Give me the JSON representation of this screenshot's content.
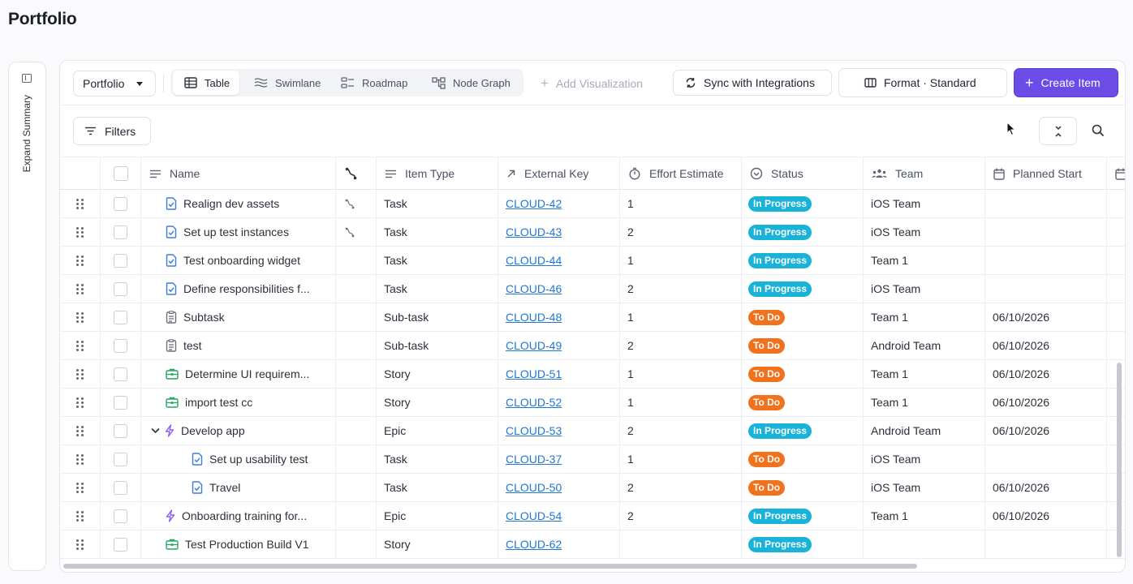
{
  "page": {
    "title": "Portfolio"
  },
  "side_panel": {
    "label": "Expand Summary"
  },
  "toolbar": {
    "portfolio_select": "Portfolio",
    "views": [
      {
        "label": "Table",
        "icon": "table-icon",
        "active": true
      },
      {
        "label": "Swimlane",
        "icon": "swimlane-icon",
        "active": false
      },
      {
        "label": "Roadmap",
        "icon": "roadmap-icon",
        "active": false
      },
      {
        "label": "Node Graph",
        "icon": "node-graph-icon",
        "active": false
      }
    ],
    "add_visualization": "Add Visualization",
    "sync_label": "Sync with Integrations",
    "format_label": "Format · Standard",
    "create_label": "Create Item"
  },
  "filters": {
    "label": "Filters"
  },
  "colors": {
    "accent": "#6b4ce6",
    "in_progress": "#19b3d9",
    "to_do": "#f2711c",
    "link": "#1f77d6"
  },
  "table": {
    "columns": [
      {
        "key": "name",
        "label": "Name",
        "icon": "lines-icon"
      },
      {
        "key": "dep",
        "label": "",
        "icon": "dependency-icon"
      },
      {
        "key": "item_type",
        "label": "Item Type",
        "icon": "lines-icon"
      },
      {
        "key": "external_key",
        "label": "External Key",
        "icon": "arrow-up-right-icon"
      },
      {
        "key": "effort",
        "label": "Effort Estimate",
        "icon": "stopwatch-icon"
      },
      {
        "key": "status",
        "label": "Status",
        "icon": "status-circle-icon"
      },
      {
        "key": "team",
        "label": "Team",
        "icon": "team-icon"
      },
      {
        "key": "planned_start",
        "label": "Planned Start",
        "icon": "calendar-icon"
      }
    ],
    "rows": [
      {
        "name": "Realign dev assets",
        "icon": "task-icon",
        "indent": 0,
        "dep": true,
        "item_type": "Task",
        "external_key": "CLOUD-42",
        "effort": "1",
        "status": "In Progress",
        "status_kind": "inprogress",
        "team": "iOS Team",
        "planned_start": ""
      },
      {
        "name": "Set up test instances",
        "icon": "task-icon",
        "indent": 0,
        "dep": true,
        "item_type": "Task",
        "external_key": "CLOUD-43",
        "effort": "2",
        "status": "In Progress",
        "status_kind": "inprogress",
        "team": "iOS Team",
        "planned_start": ""
      },
      {
        "name": "Test onboarding widget",
        "icon": "task-icon",
        "indent": 0,
        "dep": false,
        "item_type": "Task",
        "external_key": "CLOUD-44",
        "effort": "1",
        "status": "In Progress",
        "status_kind": "inprogress",
        "team": "Team 1",
        "planned_start": ""
      },
      {
        "name": "Define responsibilities f...",
        "icon": "task-icon",
        "indent": 0,
        "dep": false,
        "item_type": "Task",
        "external_key": "CLOUD-46",
        "effort": "2",
        "status": "In Progress",
        "status_kind": "inprogress",
        "team": "iOS Team",
        "planned_start": ""
      },
      {
        "name": "Subtask",
        "icon": "subtask-icon",
        "indent": 0,
        "dep": false,
        "item_type": "Sub-task",
        "external_key": "CLOUD-48",
        "effort": "1",
        "status": "To Do",
        "status_kind": "todo",
        "team": "Team 1",
        "planned_start": "06/10/2026"
      },
      {
        "name": "test",
        "icon": "subtask-icon",
        "indent": 0,
        "dep": false,
        "item_type": "Sub-task",
        "external_key": "CLOUD-49",
        "effort": "2",
        "status": "To Do",
        "status_kind": "todo",
        "team": "Android Team",
        "planned_start": "06/10/2026"
      },
      {
        "name": "Determine UI requirem...",
        "icon": "story-icon",
        "indent": 0,
        "dep": false,
        "item_type": "Story",
        "external_key": "CLOUD-51",
        "effort": "1",
        "status": "To Do",
        "status_kind": "todo",
        "team": "Team 1",
        "planned_start": "06/10/2026"
      },
      {
        "name": "import test cc",
        "icon": "story-icon",
        "indent": 0,
        "dep": false,
        "item_type": "Story",
        "external_key": "CLOUD-52",
        "effort": "1",
        "status": "To Do",
        "status_kind": "todo",
        "team": "Team 1",
        "planned_start": "06/10/2026"
      },
      {
        "name": "Develop app",
        "icon": "epic-icon",
        "indent": 0,
        "expanded": true,
        "dep": false,
        "item_type": "Epic",
        "external_key": "CLOUD-53",
        "effort": "2",
        "status": "In Progress",
        "status_kind": "inprogress",
        "team": "Android Team",
        "planned_start": "06/10/2026"
      },
      {
        "name": "Set up usability test",
        "icon": "task-icon",
        "indent": 1,
        "dep": false,
        "item_type": "Task",
        "external_key": "CLOUD-37",
        "effort": "1",
        "status": "To Do",
        "status_kind": "todo",
        "team": "iOS Team",
        "planned_start": ""
      },
      {
        "name": "Travel",
        "icon": "task-icon",
        "indent": 1,
        "dep": false,
        "item_type": "Task",
        "external_key": "CLOUD-50",
        "effort": "2",
        "status": "To Do",
        "status_kind": "todo",
        "team": "iOS Team",
        "planned_start": "06/10/2026"
      },
      {
        "name": "Onboarding training for...",
        "icon": "epic-icon",
        "indent": 0,
        "dep": false,
        "item_type": "Epic",
        "external_key": "CLOUD-54",
        "effort": "2",
        "status": "In Progress",
        "status_kind": "inprogress",
        "team": "Team 1",
        "planned_start": "06/10/2026"
      },
      {
        "name": "Test Production Build V1",
        "icon": "story-icon",
        "indent": 0,
        "dep": false,
        "item_type": "Story",
        "external_key": "CLOUD-62",
        "effort": "",
        "status": "In Progress",
        "status_kind": "inprogress",
        "team": "",
        "planned_start": ""
      }
    ]
  }
}
